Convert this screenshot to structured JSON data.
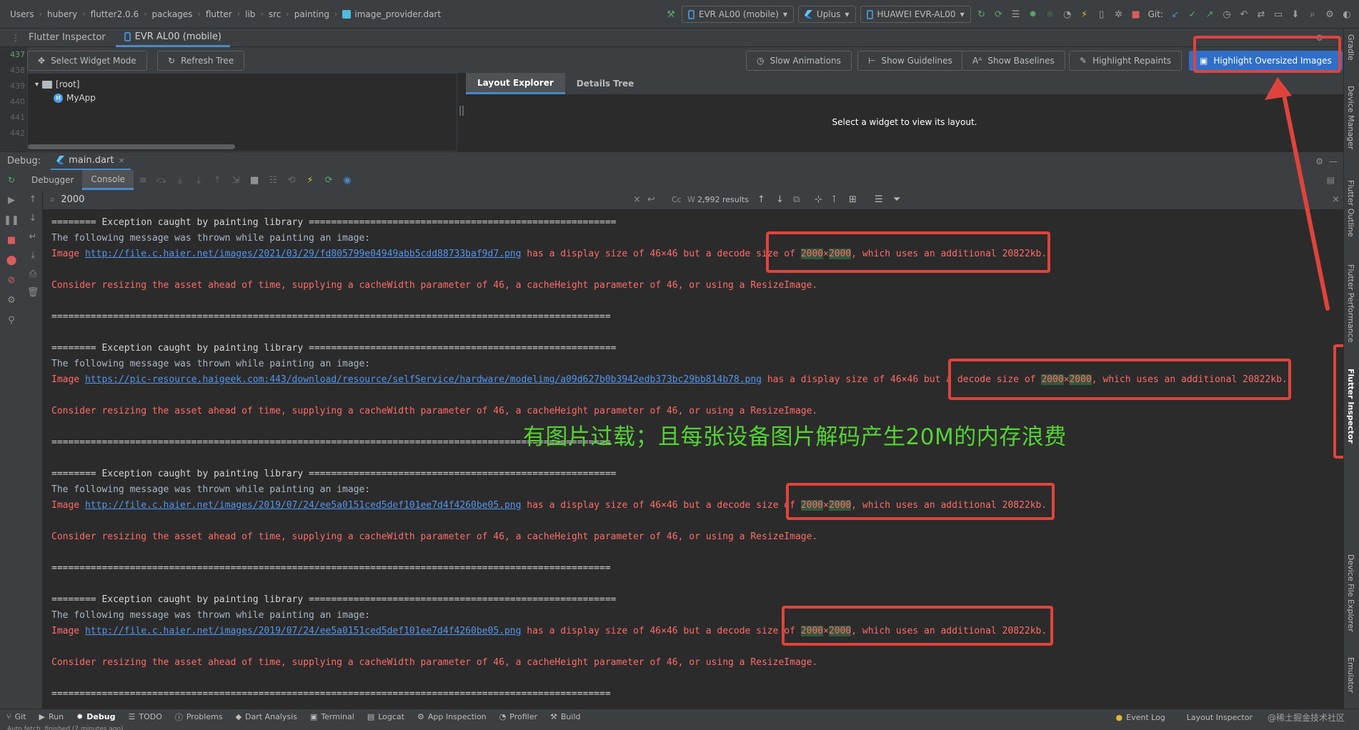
{
  "breadcrumbs": [
    "Users",
    "hubery",
    "flutter2.0.6",
    "packages",
    "flutter",
    "lib",
    "src",
    "painting",
    "image_provider.dart"
  ],
  "toolbar": {
    "device_config": "EVR AL00 (mobile)",
    "run_config": "Uplus",
    "device": "HUAWEI EVR-AL00",
    "git_label": "Git:"
  },
  "inspector": {
    "title": "Flutter Inspector",
    "tab": "EVR AL00 (mobile)",
    "buttons": {
      "select_widget_mode": "Select Widget Mode",
      "refresh_tree": "Refresh Tree",
      "slow_animations": "Slow Animations",
      "show_guidelines": "Show Guidelines",
      "show_baselines": "Show Baselines",
      "highlight_repaints": "Highlight Repaints",
      "highlight_oversized_images": "Highlight Oversized Images"
    },
    "gutter_lines": [
      "437",
      "438",
      "439",
      "440",
      "441",
      "442"
    ],
    "tree": {
      "root": "[root]",
      "child": "MyApp"
    },
    "layout_tabs": [
      "Layout Explorer",
      "Details Tree"
    ],
    "layout_message": "Select a widget to view its layout."
  },
  "debug": {
    "label": "Debug:",
    "tab": "main.dart",
    "subtabs": [
      "Debugger",
      "Console"
    ]
  },
  "search": {
    "query": "2000",
    "results": "2,992 results"
  },
  "console": {
    "header": "======== Exception caught by painting library =======================================================",
    "thrown": "The following message was thrown while painting an image:",
    "display_text": " has a display size of 46×46 but a decode size of ",
    "decode_size": "2000",
    "times": "×",
    "uses_text": ", which uses an additional 20822kb.",
    "consider": "Consider resizing the asset ahead of time, supplying a cacheWidth parameter of 46, a cacheHeight parameter of 46, or using a ResizeImage.",
    "separator": "====================================================================================================",
    "image_prefix": "Image ",
    "urls": [
      "http://file.c.haier.net/images/2021/03/29/fd805799e04949abb5cdd88733baf9d7.png",
      "https://pic-resource.haigeek.com:443/download/resource/selfService/hardware/modelimg/a09d627b0b3942edb373bc29bb814b78.png",
      "http://file.c.haier.net/images/2019/07/24/ee5a0151ced5def101ee7d4f4260be05.png",
      "http://file.c.haier.net/images/2019/07/24/ee5a0151ced5def101ee7d4f4260be05.png"
    ]
  },
  "annotation": "有图片过载；且每张设备图片解码产生20M的内存浪费",
  "right_stripe": [
    "Gradle",
    "Device Manager",
    "Flutter Outline",
    "Flutter Performance",
    "Flutter Inspector",
    "Device File Explorer",
    "Emulator"
  ],
  "statusbar": {
    "items": [
      "Git",
      "Run",
      "Debug",
      "TODO",
      "Problems",
      "Dart Analysis",
      "Terminal",
      "Logcat",
      "App Inspection",
      "Profiler",
      "Build"
    ],
    "event_log": "Event Log",
    "layout_inspector": "Layout Inspector",
    "watermark": "@稀土掘金技术社区",
    "footer": "Auto fetch: finished (7 minutes ago)"
  },
  "colors": {
    "accent": "#2f6fc7",
    "error_text": "#ff6b68",
    "annotation": "#55d234",
    "highlight_box": "#e0433b"
  }
}
